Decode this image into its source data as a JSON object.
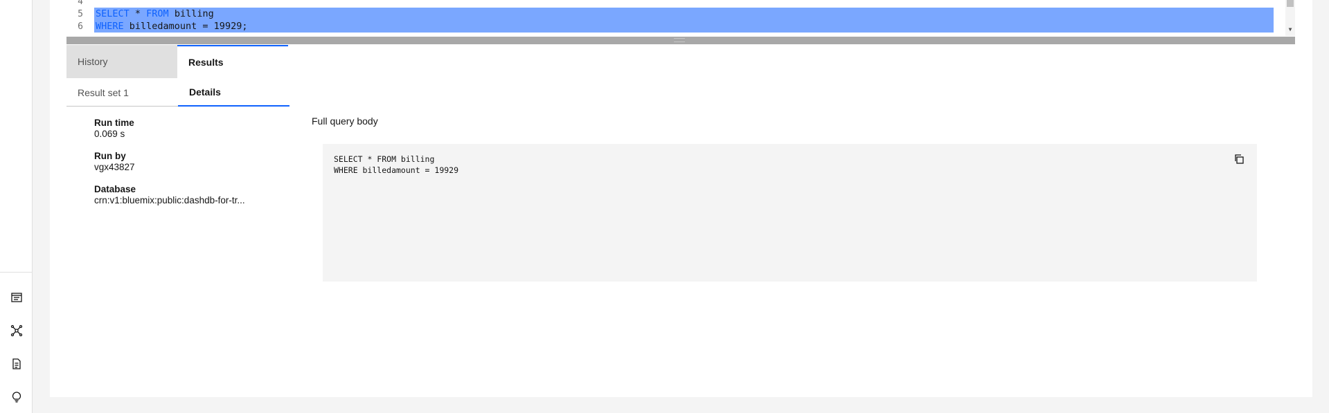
{
  "editor": {
    "lines": [
      {
        "num": "4",
        "text": ""
      },
      {
        "num": "5",
        "kw1": "SELECT",
        "mid": " * ",
        "kw2": "FROM",
        "rest": " billing"
      },
      {
        "num": "6",
        "kw1": "WHERE",
        "rest": " billedamount = 19929;"
      }
    ],
    "selection_color": "#7aa7ff"
  },
  "tabs": {
    "history": "History",
    "results": "Results"
  },
  "subtabs": {
    "result_set": "Result set 1",
    "details": "Details"
  },
  "details": {
    "run_time_label": "Run time",
    "run_time_value": "0.069 s",
    "run_by_label": "Run by",
    "run_by_value": "vgx43827",
    "database_label": "Database",
    "database_value": "crn:v1:bluemix:public:dashdb-for-tr..."
  },
  "query": {
    "heading": "Full query body",
    "body": "SELECT * FROM billing\nWHERE billedamount = 19929"
  },
  "rail": {
    "icons": [
      "sql-editor-icon",
      "data-model-icon",
      "document-icon",
      "lightbulb-icon"
    ]
  },
  "colors": {
    "accent": "#0f62fe",
    "keyword": "#0f62fe"
  }
}
